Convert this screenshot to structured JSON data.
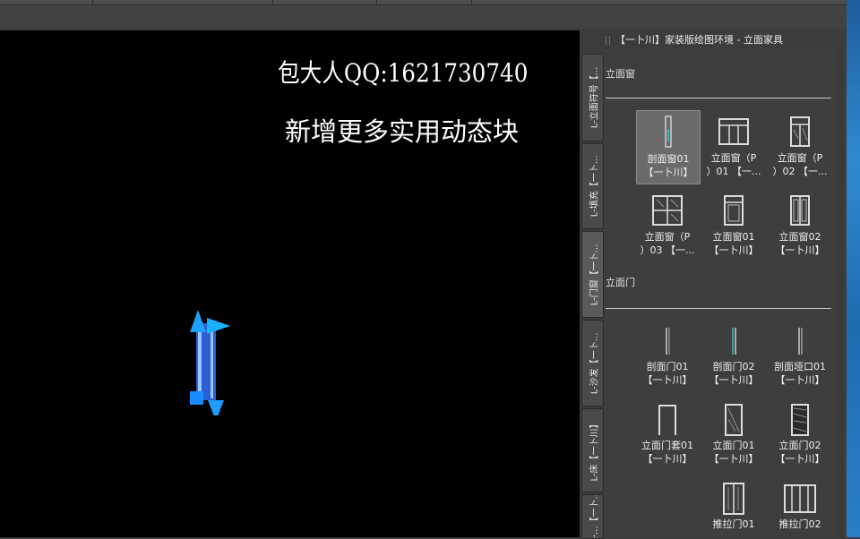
{
  "canvas": {
    "overlay_line1": "包大人QQ:1621730740",
    "overlay_line2": "新增更多实用动态块"
  },
  "palette": {
    "title": "【一卜川】家装版绘图环境 - 立面家具",
    "tabs": [
      "L-立面符号【...",
      "L-填充【一卜...",
      "L-门窗【一卜...",
      "L-沙发【一卜...",
      "L-床【一卜川】",
      "L-...【一卜..."
    ],
    "sections": [
      {
        "label": "立面窗",
        "items": [
          {
            "label": "剖面窗01\n【一卜川】",
            "icon": "section-window-icon"
          },
          {
            "label": "立面窗（P\n）01 【一...",
            "icon": "elevation-window-icon"
          },
          {
            "label": "立面窗（P\n）02 【一...",
            "icon": "elevation-window-icon"
          },
          {
            "label": "立面窗（P\n）03 【一...",
            "icon": "elevation-window-icon"
          },
          {
            "label": "立面窗01\n【一卜川】",
            "icon": "elevation-window-icon"
          },
          {
            "label": "立面窗02\n【一卜川】",
            "icon": "elevation-window-icon"
          }
        ]
      },
      {
        "label": "立面门",
        "items": [
          {
            "label": "剖面门01\n【一卜川】",
            "icon": "section-door-icon"
          },
          {
            "label": "剖面门02\n【一卜川】",
            "icon": "section-door-icon"
          },
          {
            "label": "剖面垭口01\n【一卜川】",
            "icon": "section-opening-icon"
          },
          {
            "label": "立面门套01\n【一卜川】",
            "icon": "door-frame-icon"
          },
          {
            "label": "立面门01\n【一卜川】",
            "icon": "elevation-door-icon"
          },
          {
            "label": "立面门02\n【一卜川】",
            "icon": "elevation-door-icon"
          },
          {
            "label": "推拉门01",
            "icon": "sliding-door-icon"
          },
          {
            "label": "推拉门02",
            "icon": "sliding-door-icon"
          }
        ]
      }
    ]
  }
}
